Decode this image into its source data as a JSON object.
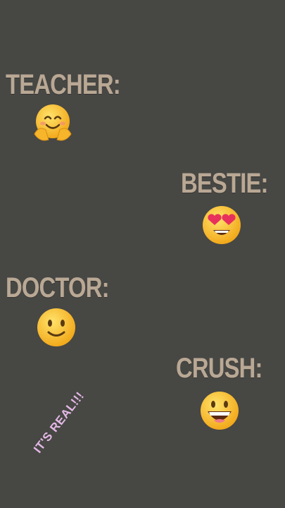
{
  "entries": [
    {
      "label": "TEACHER:",
      "emoji": "hugging-face-icon"
    },
    {
      "label": "BESTIE:",
      "emoji": "heart-eyes-face-icon"
    },
    {
      "label": "DOCTOR:",
      "emoji": "slightly-smiling-face-icon"
    },
    {
      "label": "CRUSH:",
      "emoji": "grinning-face-icon"
    }
  ],
  "stamp": "IT'S REAL!!!",
  "colors": {
    "background": "#474744",
    "label": "#b9a894",
    "stamp": "#e4b8e6",
    "emoji_face": "#f9c22b"
  }
}
